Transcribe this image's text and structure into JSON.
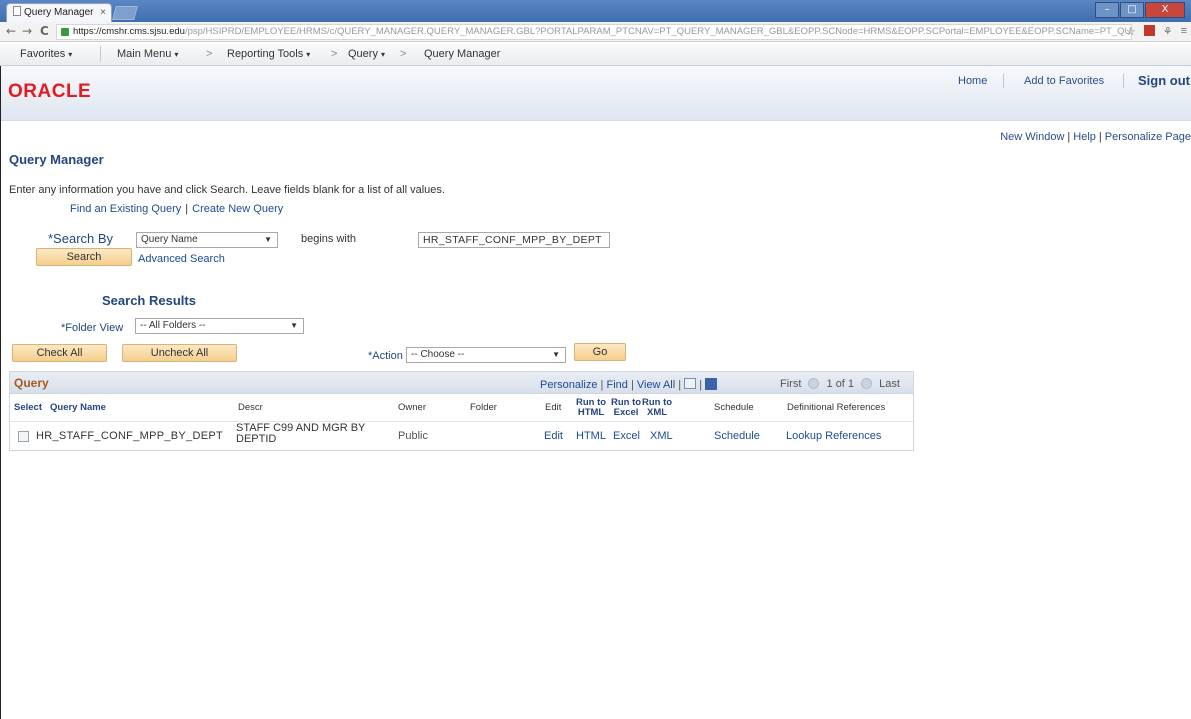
{
  "browser": {
    "tab_title": "Query Manager",
    "tab_close": "×",
    "url_host": "https://cmshr.cms.sjsu.edu",
    "url_path": "/psp/HSIPRD/EMPLOYEE/HRMS/c/QUERY_MANAGER.QUERY_MANAGER.GBL?PORTALPARAM_PTCNAV=PT_QUERY_MANAGER_GBL&EOPP.SCNode=HRMS&EOPP.SCPortal=EMPLOYEE&EOPP.SCName=PT_QU",
    "back": "←",
    "forward": "→",
    "reload": "C",
    "win_min": "–",
    "win_max": "□",
    "win_close": "X"
  },
  "menubar": {
    "favorites": "Favorites",
    "main_menu": "Main Menu",
    "sep1": ">",
    "reporting_tools": "Reporting Tools",
    "sep2": ">",
    "query": "Query",
    "sep3": ">",
    "query_manager": "Query Manager"
  },
  "header": {
    "logo": "ORACLE",
    "home": "Home",
    "add_to_favorites": "Add to Favorites",
    "sign_out": "Sign out"
  },
  "page_links": {
    "new_window": "New Window",
    "help": "Help",
    "personalize_page": "Personalize Page",
    "bar": "|"
  },
  "page": {
    "title": "Query Manager",
    "instructions": "Enter any information you have and click Search. Leave fields blank for a list of all values.",
    "find_existing": "Find an Existing Query",
    "pipe": "|",
    "create_new": "Create New Query"
  },
  "search": {
    "search_by_label": "*Search By",
    "search_by_value": "Query Name",
    "operator": "begins with",
    "value": "HR_STAFF_CONF_MPP_BY_DEPT",
    "search_button": "Search",
    "advanced_search": "Advanced Search"
  },
  "results": {
    "title": "Search Results",
    "folder_view_label": "*Folder View",
    "folder_view_value": "-- All Folders --",
    "check_all": "Check All",
    "uncheck_all": "Uncheck All",
    "action_label": "*Action",
    "action_value": "-- Choose --",
    "go": "Go"
  },
  "grid": {
    "title": "Query",
    "personalize": "Personalize",
    "find": "Find",
    "view_all": "View All",
    "pipe": "|",
    "first": "First",
    "page_info": "1 of 1",
    "last": "Last",
    "columns": {
      "select": "Select",
      "query_name": "Query Name",
      "descr": "Descr",
      "owner": "Owner",
      "folder": "Folder",
      "edit": "Edit",
      "run_html_1": "Run to",
      "run_html_2": "HTML",
      "run_excel_1": "Run to",
      "run_excel_2": "Excel",
      "run_xml_1": "Run to",
      "run_xml_2": "XML",
      "schedule": "Schedule",
      "definitional_references": "Definitional References"
    },
    "rows": [
      {
        "query_name": "HR_STAFF_CONF_MPP_BY_DEPT",
        "descr_line1": "STAFF C99 AND MGR BY",
        "descr_line2": "DEPTID",
        "owner": "Public",
        "folder": "",
        "edit": "Edit",
        "html": "HTML",
        "excel": "Excel",
        "xml": "XML",
        "schedule": "Schedule",
        "references": "Lookup References"
      }
    ]
  }
}
